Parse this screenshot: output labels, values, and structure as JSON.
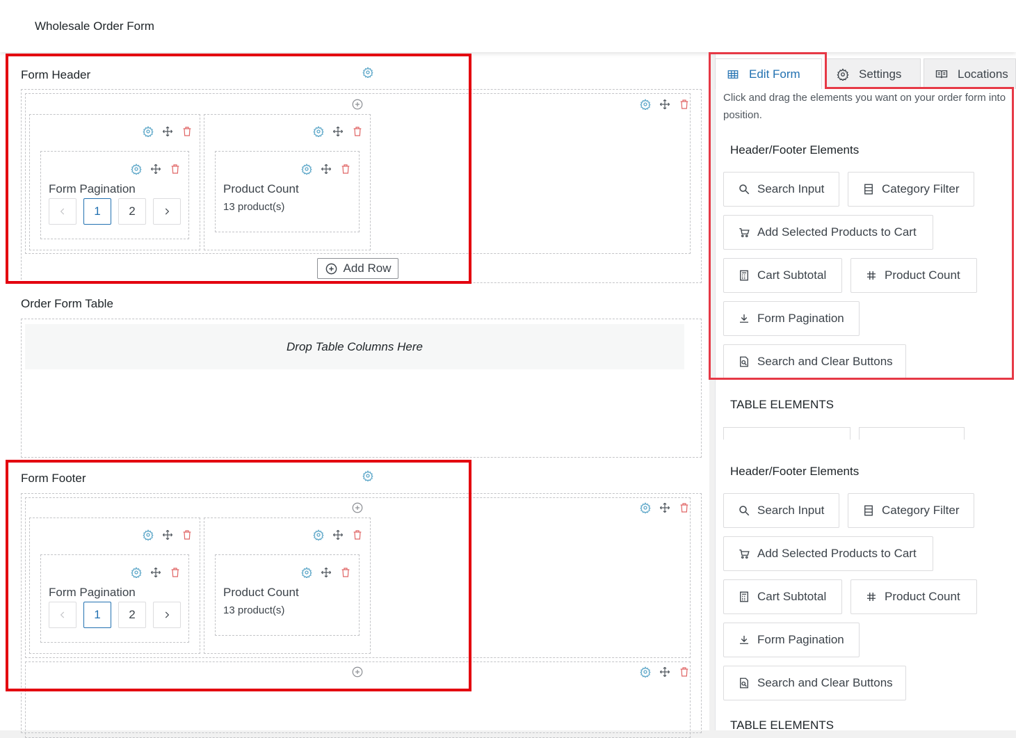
{
  "page": {
    "title": "Wholesale Order Form"
  },
  "colors": {
    "accent": "#2271b1",
    "gear": "#5fa8c9",
    "delete": "#e06666",
    "highlight": "#e3000f"
  },
  "header_section": {
    "title": "Form Header",
    "add_row_label": "Add Row",
    "pagination": {
      "label": "Form Pagination",
      "pages": [
        "1",
        "2"
      ],
      "current": "1"
    },
    "product_count": {
      "label": "Product Count",
      "value": "13 product(s)"
    }
  },
  "table_section": {
    "title": "Order Form Table",
    "drop_hint": "Drop Table Columns Here"
  },
  "footer_section": {
    "title": "Form Footer",
    "pagination": {
      "label": "Form Pagination",
      "pages": [
        "1",
        "2"
      ],
      "current": "1"
    },
    "product_count": {
      "label": "Product Count",
      "value": "13 product(s)"
    }
  },
  "sidebar": {
    "tabs": [
      {
        "label": "Edit Form",
        "icon": "table-icon",
        "active": true
      },
      {
        "label": "Settings",
        "icon": "gear-icon",
        "active": false
      },
      {
        "label": "Locations",
        "icon": "book-icon",
        "active": false
      }
    ],
    "hint": "Click and drag the elements you want on your order form into position.",
    "header_footer_title": "Header/Footer Elements",
    "table_elements_title": "TABLE ELEMENTS",
    "elements": [
      {
        "label": "Search Input",
        "icon": "search-icon"
      },
      {
        "label": "Category Filter",
        "icon": "list-icon"
      },
      {
        "label": "Add Selected Products to Cart",
        "icon": "cart-icon"
      },
      {
        "label": "Cart Subtotal",
        "icon": "calculator-icon"
      },
      {
        "label": "Product Count",
        "icon": "hash-icon"
      },
      {
        "label": "Form Pagination",
        "icon": "download-icon"
      },
      {
        "label": "Search and Clear Buttons",
        "icon": "search-doc-icon"
      }
    ]
  }
}
